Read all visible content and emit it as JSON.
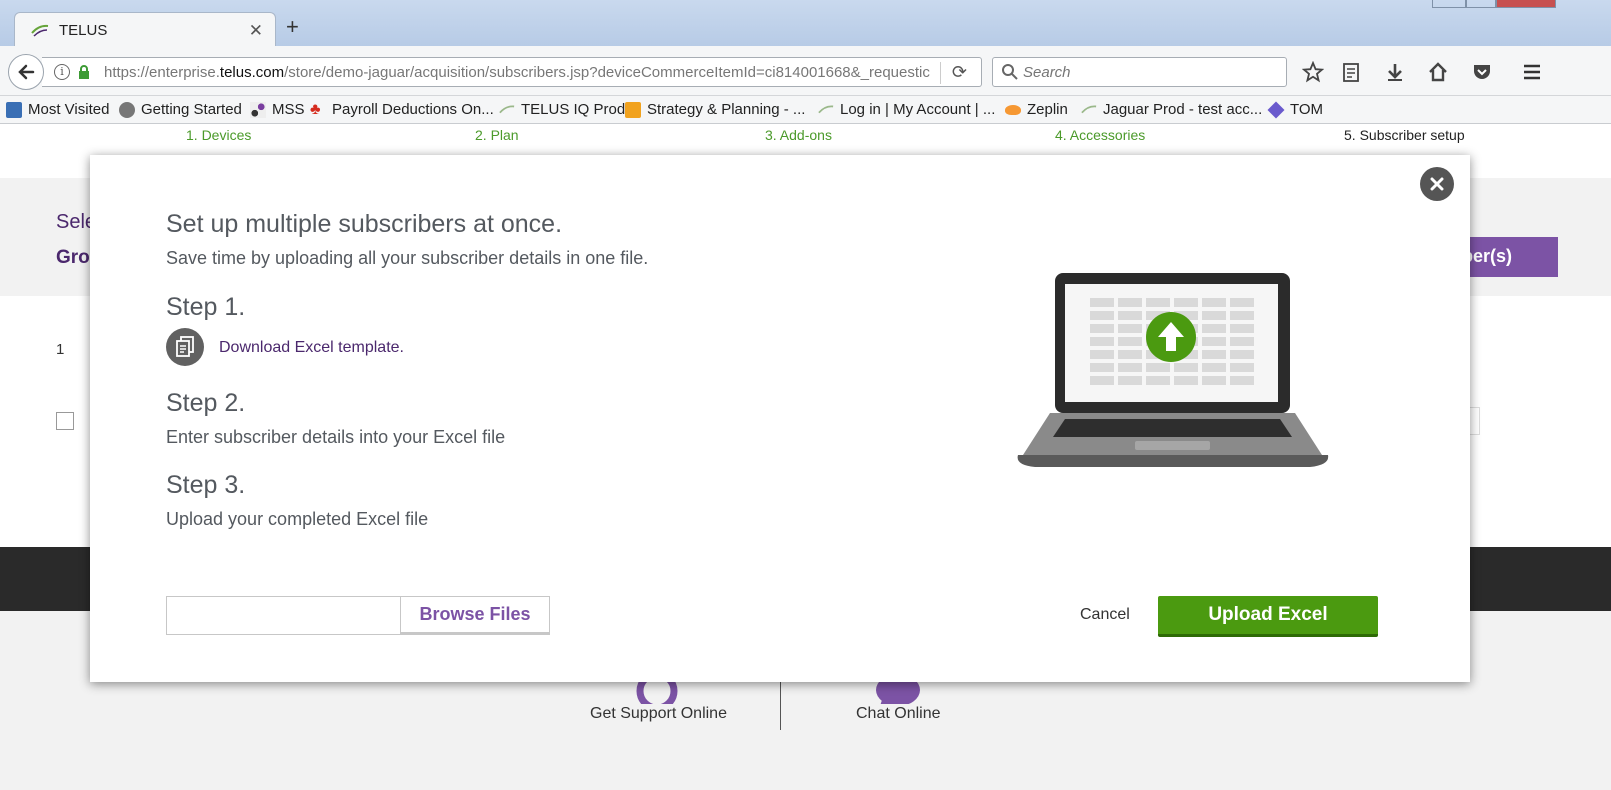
{
  "browser": {
    "tab_title": "TELUS",
    "url_host_prefix": "https://enterprise.",
    "url_host_domain": "telus.com",
    "url_path": "/store/demo-jaguar/acquisition/subscribers.jsp?deviceCommerceItemId=ci814001668&_requestic",
    "search_placeholder": "Search",
    "bookmarks": [
      {
        "label": "Most Visited",
        "icon": "most-visited-icon"
      },
      {
        "label": "Getting Started",
        "icon": "globe-icon"
      },
      {
        "label": "MSS",
        "icon": "mss-icon"
      },
      {
        "label": "Payroll Deductions On...",
        "icon": "maple-leaf-icon"
      },
      {
        "label": "TELUS IQ Prod",
        "icon": "telus-icon"
      },
      {
        "label": "Strategy & Planning - ...",
        "icon": "grid-icon"
      },
      {
        "label": "Log in | My Account | ...",
        "icon": "telus-icon"
      },
      {
        "label": "Zeplin",
        "icon": "zeplin-icon"
      },
      {
        "label": "Jaguar Prod - test acc...",
        "icon": "telus-icon"
      },
      {
        "label": "TOM",
        "icon": "diamond-icon"
      }
    ]
  },
  "progress_steps": [
    {
      "label": "1. Devices",
      "state": "done"
    },
    {
      "label": "2. Plan",
      "state": "done"
    },
    {
      "label": "3. Add-ons",
      "state": "done"
    },
    {
      "label": "4. Accessories",
      "state": "done"
    },
    {
      "label": "5. Subscriber setup",
      "state": "current"
    }
  ],
  "background": {
    "select_partial": "Sele",
    "group_partial": "Gro",
    "button_partial": "criber(s)",
    "row_number": "1",
    "support_label": "Get Support Online",
    "chat_label": "Chat Online"
  },
  "modal": {
    "title": "Set up multiple subscribers at once.",
    "subtitle": "Save time by uploading all your subscriber details in one file.",
    "step1_heading": "Step 1.",
    "step1_link": "Download Excel template.",
    "step2_heading": "Step 2.",
    "step2_desc": "Enter subscriber details into your Excel file",
    "step3_heading": "Step 3.",
    "step3_desc": "Upload your completed Excel file",
    "file_input_value": "",
    "browse_label": "Browse Files",
    "cancel_label": "Cancel",
    "upload_label": "Upload Excel"
  },
  "colors": {
    "brand_purple": "#4b286d",
    "accent_purple": "#7c53a5",
    "brand_green": "#4b9a10",
    "step_green": "#4b9a2a"
  }
}
